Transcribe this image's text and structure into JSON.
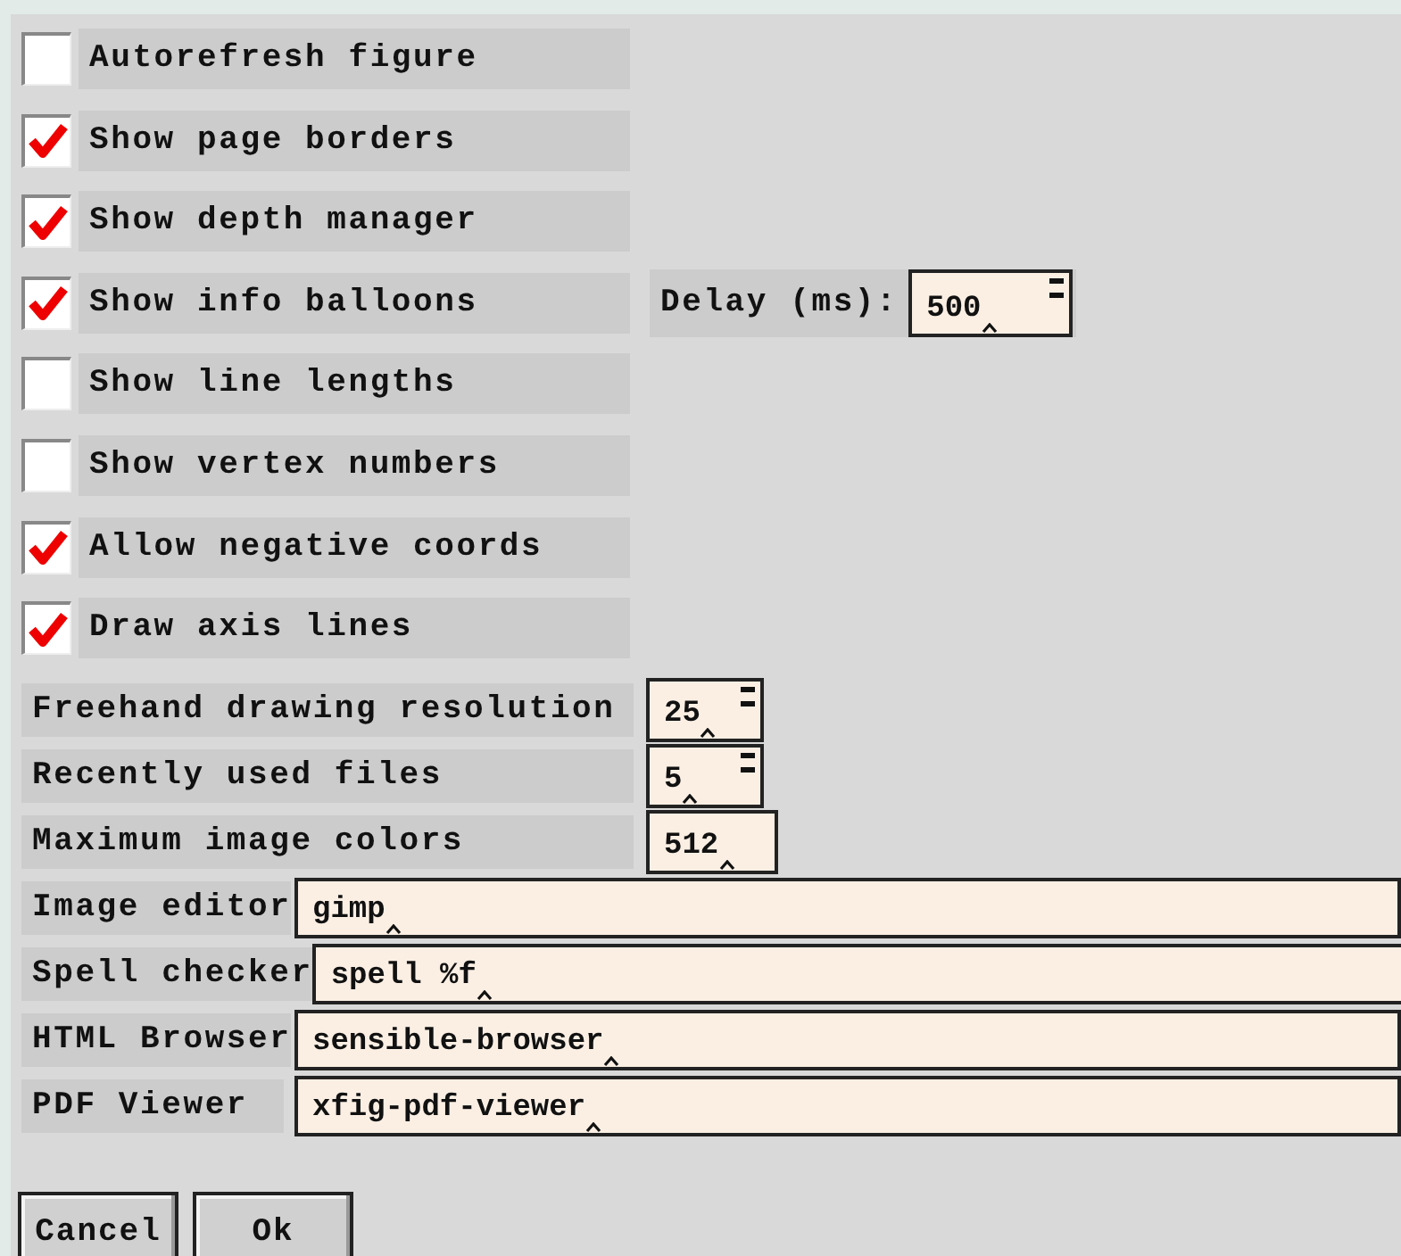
{
  "options": [
    {
      "label": "Autorefresh figure",
      "checked": false
    },
    {
      "label": "Show page borders",
      "checked": true
    },
    {
      "label": "Show depth manager",
      "checked": true
    },
    {
      "label": "Show info balloons",
      "checked": true,
      "extra": {
        "label": "Delay (ms):",
        "value": "500"
      }
    },
    {
      "label": "Show line lengths",
      "checked": false
    },
    {
      "label": "Show vertex numbers",
      "checked": false
    },
    {
      "label": "Allow negative coords",
      "checked": true
    },
    {
      "label": "Draw axis lines",
      "checked": true
    }
  ],
  "numbers": [
    {
      "label": "Freehand drawing resolution",
      "value": "25",
      "kind": "spinner"
    },
    {
      "label": "Recently used files",
      "value": "5",
      "kind": "spinner"
    },
    {
      "label": "Maximum image colors",
      "value": "512",
      "kind": "plain"
    }
  ],
  "programs": [
    {
      "label": "Image editor",
      "value": "gimp"
    },
    {
      "label": "Spell checker",
      "value": "spell %f"
    },
    {
      "label": "HTML Browser",
      "value": "sensible-browser"
    },
    {
      "label": "PDF Viewer",
      "value": "xfig-pdf-viewer"
    }
  ],
  "buttons": [
    "Cancel",
    "Ok"
  ]
}
